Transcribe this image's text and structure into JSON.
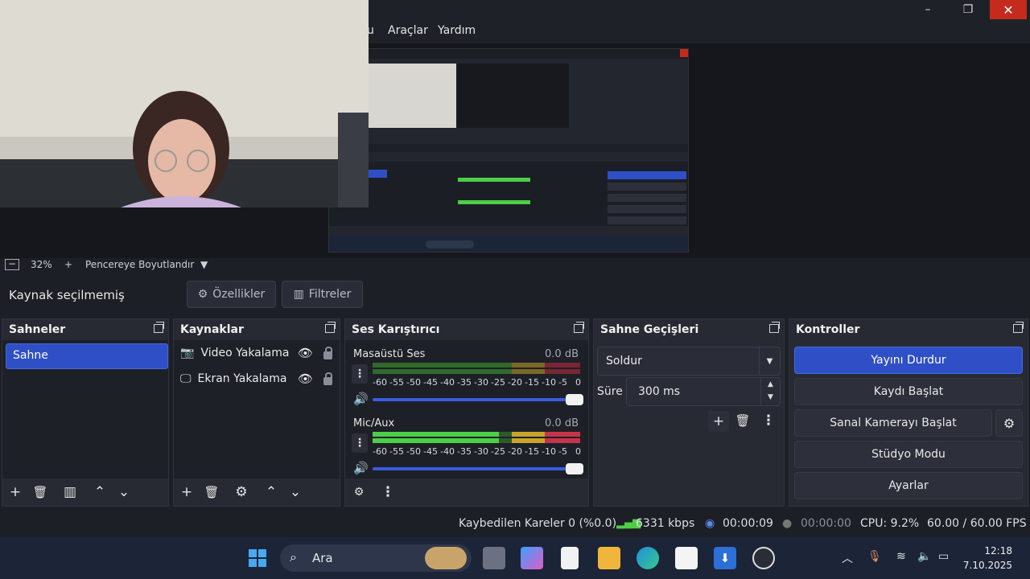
{
  "window": {
    "menu": [
      "u",
      "Araçlar",
      "Yardım"
    ],
    "min": "–",
    "max": "❐",
    "close": "✕"
  },
  "zoom": {
    "minus": "−",
    "value": "32%",
    "plus": "+",
    "mode": "Pencereye Boyutlandır",
    "dropdown": "▼"
  },
  "context": {
    "label": "Kaynak seçilmemiş",
    "properties": "Özellikler",
    "filters": "Filtreler"
  },
  "scenes": {
    "title": "Sahneler",
    "items": [
      "Sahne"
    ]
  },
  "sources": {
    "title": "Kaynaklar",
    "items": [
      {
        "label": "Video Yakalama",
        "icon": "camera-icon"
      },
      {
        "label": "Ekran Yakalama",
        "icon": "monitor-icon"
      }
    ]
  },
  "mixer": {
    "title": "Ses Karıştırıcı",
    "ticks": [
      "-60",
      "-55",
      "-50",
      "-45",
      "-40",
      "-35",
      "-30",
      "-25",
      "-20",
      "-15",
      "-10",
      "-5",
      "0"
    ],
    "channels": [
      {
        "name": "Masaüstü Ses",
        "db": "0.0 dB",
        "level": 0,
        "volume": 1.0
      },
      {
        "name": "Mic/Aux",
        "db": "0.0 dB",
        "level": 0.61,
        "volume": 1.0
      }
    ]
  },
  "transitions": {
    "title": "Sahne Geçişleri",
    "selected": "Soldur",
    "duration_label": "Süre",
    "duration_value": "300 ms"
  },
  "controls": {
    "title": "Kontroller",
    "stop_stream": "Yayını Durdur",
    "start_record": "Kaydı Başlat",
    "virtual_cam": "Sanal Kamerayı Başlat",
    "studio_mode": "Stüdyo Modu",
    "settings": "Ayarlar"
  },
  "status": {
    "dropped": "Kaybedilen Kareler 0 (%0.0)",
    "bitrate": "6331 kbps",
    "stream_time": "00:00:09",
    "record_time": "00:00:00",
    "cpu": "CPU: 9.2%",
    "fps": "60.00 / 60.00 FPS"
  },
  "taskbar": {
    "search": "Ara",
    "time": "12:18",
    "date": "7.10.2025"
  },
  "colors": {
    "accent": "#2f4fc7",
    "close": "#c42b1c",
    "meter_green": "#4cce46",
    "meter_yellow": "#c8a52a",
    "meter_red": "#c6344a"
  }
}
